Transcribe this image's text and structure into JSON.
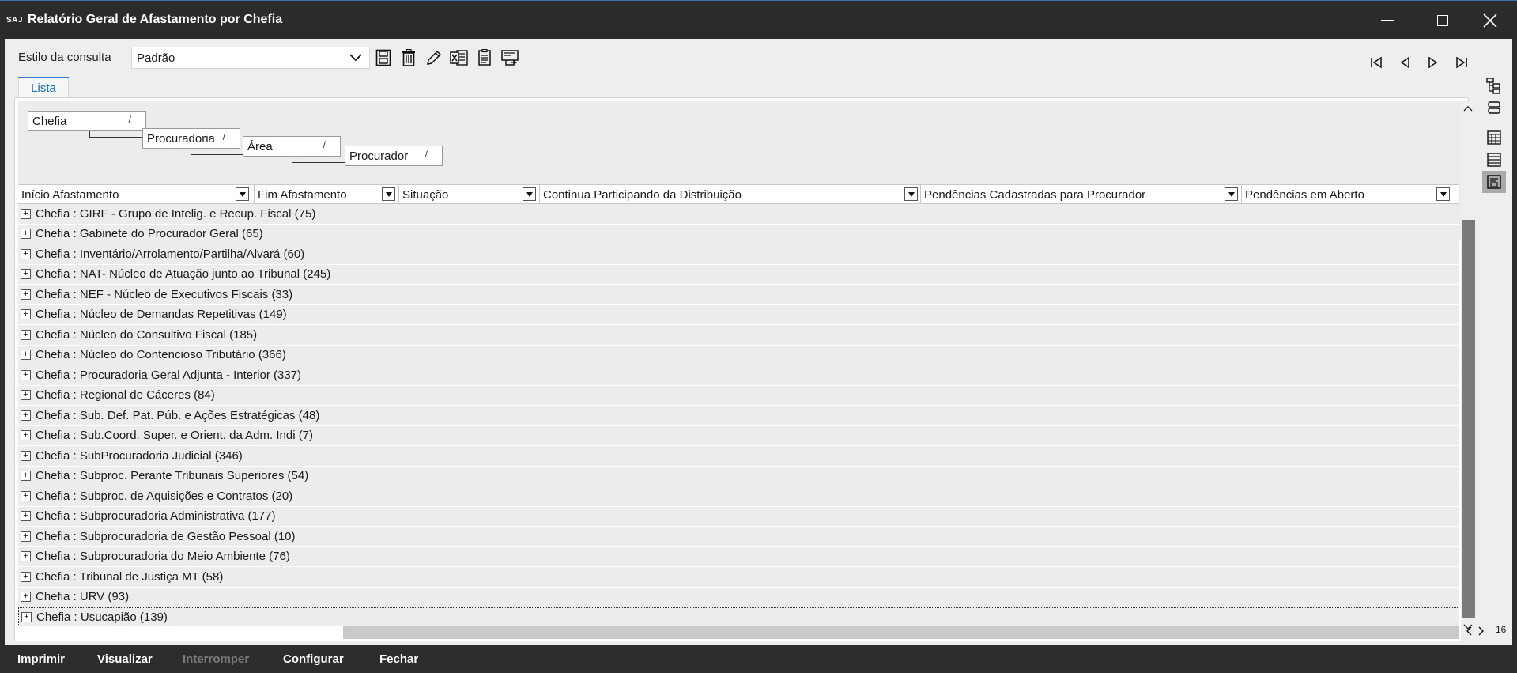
{
  "window": {
    "logo": "SAJ",
    "title": "Relatório Geral de Afastamento por Chefia"
  },
  "toolbar": {
    "style_label": "Estilo da consulta",
    "style_value": "Padrão"
  },
  "tabs": [
    {
      "label": "Lista"
    }
  ],
  "grouping": [
    "Chefia",
    "Procuradoria",
    "Área",
    "Procurador"
  ],
  "columns": [
    "Início Afastamento",
    "Fim Afastamento",
    "Situação",
    "Continua Participando da Distribuição",
    "Pendências Cadastradas para Procurador",
    "Pendências em Aberto"
  ],
  "rows": [
    "Chefia : GIRF - Grupo de Intelig. e Recup. Fiscal (75)",
    "Chefia : Gabinete do Procurador Geral (65)",
    "Chefia : Inventário/Arrolamento/Partilha/Alvará (60)",
    "Chefia : NAT- Núcleo de Atuação junto ao Tribunal (245)",
    "Chefia : NEF - Núcleo de Executivos Fiscais (33)",
    "Chefia : Núcleo de Demandas Repetitivas (149)",
    "Chefia : Núcleo do Consultivo Fiscal (185)",
    "Chefia : Núcleo do Contencioso Tributário (366)",
    "Chefia : Procuradoria Geral Adjunta - Interior (337)",
    "Chefia : Regional de Cáceres (84)",
    "Chefia : Sub. Def. Pat. Púb. e Ações Estratégicas (48)",
    "Chefia : Sub.Coord. Super. e Orient. da Adm. Indi (7)",
    "Chefia : SubProcuradoria Judicial (346)",
    "Chefia : Subproc. Perante Tribunais Superiores (54)",
    "Chefia : Subproc. de Aquisições e Contratos (20)",
    "Chefia : Subprocuradoria Administrativa (177)",
    "Chefia : Subprocuradoria de Gestão Pessoal (10)",
    "Chefia : Subprocuradoria do Meio Ambiente (76)",
    "Chefia : Tribunal de Justiça MT (58)",
    "Chefia : URV (93)",
    "Chefia : Usucapião (139)"
  ],
  "page_count": "16",
  "bottom": {
    "print": "Imprimir",
    "preview": "Visualizar",
    "interrupt": "Interromper",
    "configure": "Configurar",
    "close": "Fechar"
  },
  "icons": {
    "toolbar": [
      "save-icon",
      "delete-icon",
      "edit-icon",
      "excel-export-icon",
      "document-icon",
      "print-export-icon"
    ],
    "nav": [
      "first-page-icon",
      "previous-page-icon",
      "next-page-icon",
      "last-page-icon"
    ],
    "side": [
      "tree-view-icon",
      "group-view-icon",
      "table-view-icon",
      "list-view-icon",
      "report-view-icon"
    ]
  }
}
